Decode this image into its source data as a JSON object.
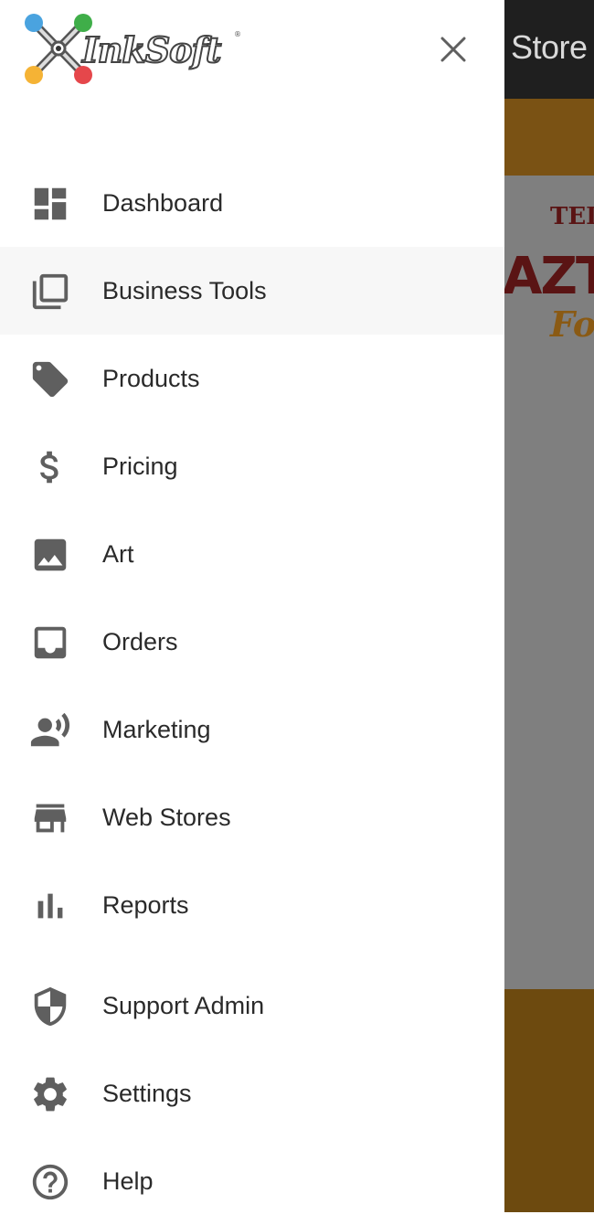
{
  "app": {
    "logo_text": "InkSoft"
  },
  "background": {
    "topbar_title": "Store",
    "hero": {
      "line1": "TEI",
      "line2": "AZT",
      "line3": "Fo"
    }
  },
  "drawer": {
    "nav": [
      {
        "id": "dashboard",
        "label": "Dashboard",
        "icon": "dashboard-icon",
        "active": false
      },
      {
        "id": "business-tools",
        "label": "Business Tools",
        "icon": "library-icon",
        "active": true
      },
      {
        "id": "products",
        "label": "Products",
        "icon": "tag-icon",
        "active": false
      },
      {
        "id": "pricing",
        "label": "Pricing",
        "icon": "dollar-icon",
        "active": false
      },
      {
        "id": "art",
        "label": "Art",
        "icon": "image-icon",
        "active": false
      },
      {
        "id": "orders",
        "label": "Orders",
        "icon": "inbox-icon",
        "active": false
      },
      {
        "id": "marketing",
        "label": "Marketing",
        "icon": "record-voice-icon",
        "active": false
      },
      {
        "id": "web-stores",
        "label": "Web Stores",
        "icon": "store-icon",
        "active": false
      },
      {
        "id": "reports",
        "label": "Reports",
        "icon": "bar-chart-icon",
        "active": false
      },
      {
        "id": "support-admin",
        "label": "Support Admin",
        "icon": "shield-icon",
        "active": false
      },
      {
        "id": "settings",
        "label": "Settings",
        "icon": "gear-icon",
        "active": false
      },
      {
        "id": "help",
        "label": "Help",
        "icon": "help-circle-icon",
        "active": false
      }
    ]
  },
  "colors": {
    "icon": "#5f5f5f",
    "label": "#2a2a2a",
    "active_bg": "#f7f7f7"
  }
}
